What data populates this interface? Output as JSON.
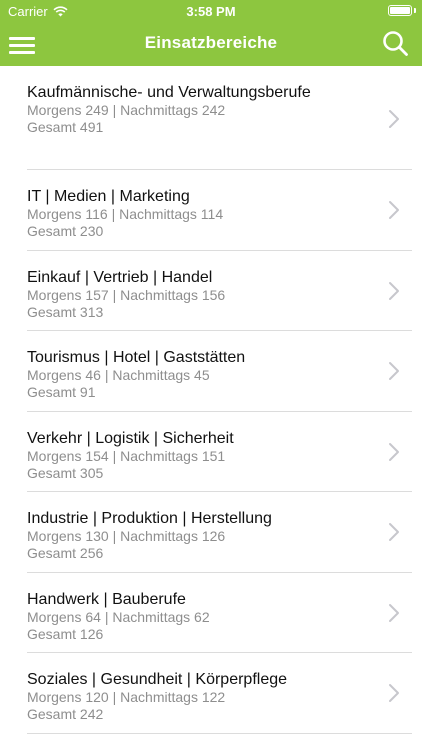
{
  "status_bar": {
    "carrier": "Carrier",
    "time": "3:58 PM"
  },
  "nav": {
    "title": "Einsatzbereiche"
  },
  "items": [
    {
      "title": "Kaufmännische- und Verwaltungsberufe",
      "line1": "Morgens 249 | Nachmittags 242",
      "line2": "Gesamt 491"
    },
    {
      "title": "IT | Medien | Marketing",
      "line1": "Morgens 116 | Nachmittags 114",
      "line2": "Gesamt 230"
    },
    {
      "title": "Einkauf | Vertrieb | Handel",
      "line1": "Morgens 157 | Nachmittags 156",
      "line2": "Gesamt 313"
    },
    {
      "title": "Tourismus | Hotel | Gaststätten",
      "line1": "Morgens 46 | Nachmittags 45",
      "line2": "Gesamt 91"
    },
    {
      "title": "Verkehr | Logistik | Sicherheit",
      "line1": "Morgens 154 | Nachmittags 151",
      "line2": "Gesamt 305"
    },
    {
      "title": "Industrie | Produktion | Herstellung",
      "line1": "Morgens 130 | Nachmittags 126",
      "line2": "Gesamt 256"
    },
    {
      "title": "Handwerk | Bauberufe",
      "line1": "Morgens 64 | Nachmittags 62",
      "line2": "Gesamt 126"
    },
    {
      "title": "Soziales | Gesundheit | Körperpflege",
      "line1": "Morgens 120 | Nachmittags 122",
      "line2": "Gesamt 242"
    }
  ],
  "colors": {
    "accent": "#8dc63f",
    "subtitle": "#8e8e8e",
    "separator": "#dcdcdc",
    "chevron": "#c7c7cc"
  },
  "icons": {
    "menu": "hamburger-icon",
    "search": "search-icon",
    "row": "chevron-right-icon"
  }
}
